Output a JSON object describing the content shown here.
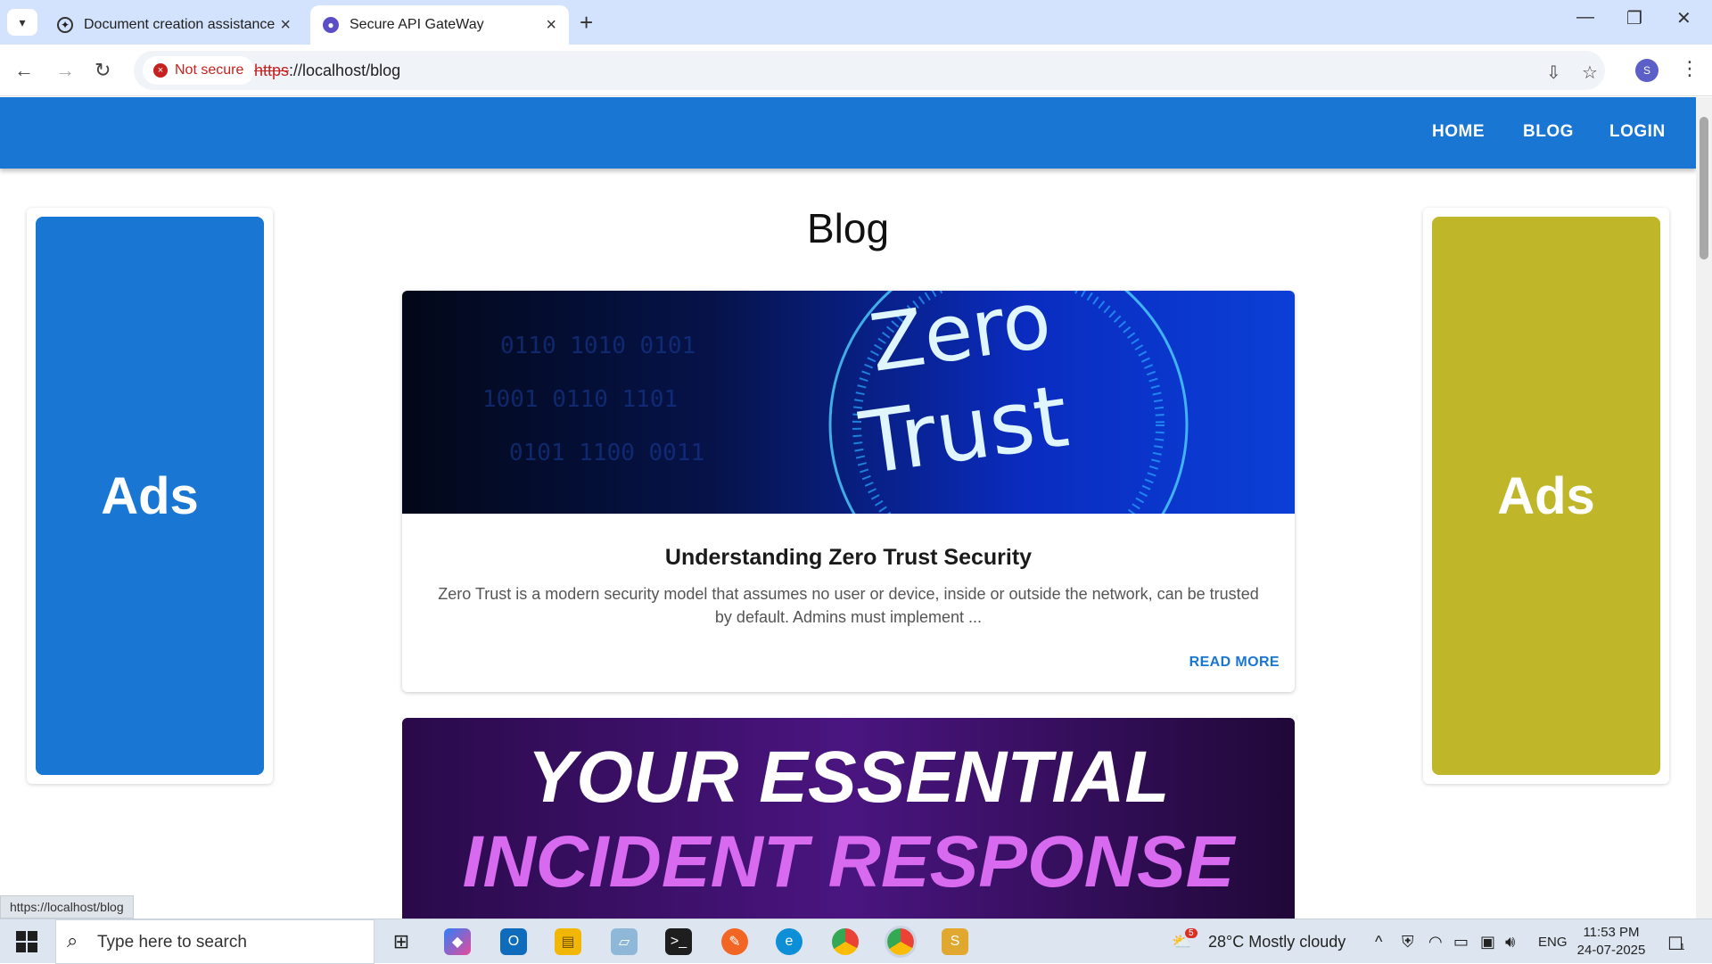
{
  "browser": {
    "tabs": [
      {
        "title": "Document creation assistance",
        "active": false
      },
      {
        "title": "Secure API GateWay",
        "active": true
      }
    ],
    "security_label": "Not secure",
    "url_scheme": "https",
    "url_rest": "://localhost/blog",
    "profile_initial": "S",
    "status_url": "https://localhost/blog"
  },
  "site": {
    "nav": [
      "HOME",
      "BLOG",
      "LOGIN"
    ],
    "page_title": "Blog",
    "ads_label": "Ads",
    "colors": {
      "appbar": "#1976d2",
      "ad_left": "#1976d2",
      "ad_right": "#c0b62a"
    },
    "posts": [
      {
        "image_text_1": "Zero",
        "image_text_2": "Trust",
        "title": "Understanding Zero Trust Security",
        "excerpt": "Zero Trust is a modern security model that assumes no user or device, inside or outside the network, can be trusted by default. Admins must implement ...",
        "action": "READ MORE"
      },
      {
        "image_text_1": "YOUR ESSENTIAL",
        "image_text_2": "INCIDENT RESPONSE"
      }
    ]
  },
  "taskbar": {
    "search_placeholder": "Type here to search",
    "weather_badge": "5",
    "weather": "28°C  Mostly cloudy",
    "lang": "ENG",
    "time": "11:53 PM",
    "date": "24-07-2025",
    "notif_count": "1"
  }
}
